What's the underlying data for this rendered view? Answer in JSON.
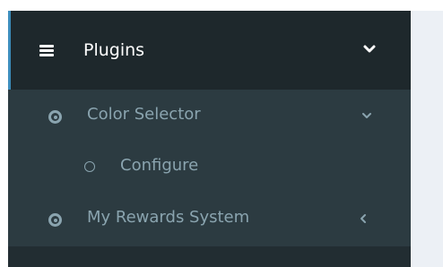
{
  "sidebar": {
    "header": {
      "label": "Plugins",
      "icon": "hamburger-icon",
      "toggle_icon": "chevron-down-icon"
    },
    "items": [
      {
        "label": "Color Selector",
        "icon": "dot-circle-icon",
        "toggle_icon": "chevron-down-icon",
        "expanded": true
      },
      {
        "label": "Configure",
        "icon": "circle-outline-icon",
        "level": 2
      },
      {
        "label": "My Rewards System",
        "icon": "dot-circle-icon",
        "toggle_icon": "angle-left-icon",
        "expanded": false
      }
    ]
  },
  "colors": {
    "sidebar_bg": "#222d32",
    "header_bg": "#1e282c",
    "submenu_bg": "#2c3b41",
    "text_muted": "#8aa4af",
    "accent": "#3c8dbc",
    "content_bg": "#ecf0f5"
  }
}
